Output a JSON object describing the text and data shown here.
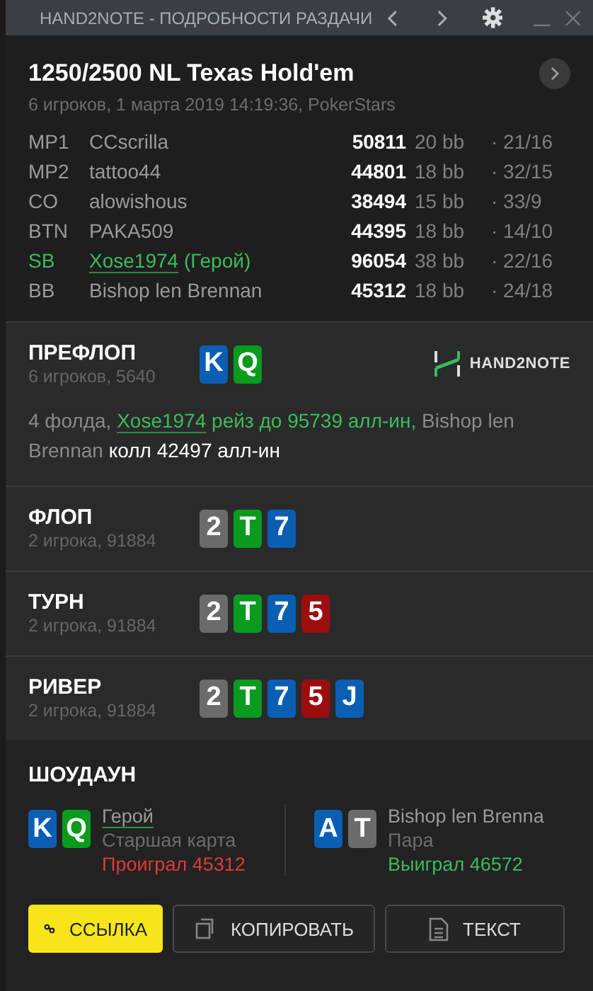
{
  "window": {
    "title": "HAND2NOTE - ПОДРОБНОСТИ РАЗДАЧИ"
  },
  "hand": {
    "title": "1250/2500 NL Texas Hold'em",
    "subtitle": "6 игроков, 1 марта 2019 14:19:36, PokerStars"
  },
  "seats": [
    {
      "position": "MP1",
      "name": "CCscrilla",
      "hero": false,
      "stack": "50811",
      "bb": "20 bb",
      "stats": "· 21/16"
    },
    {
      "position": "MP2",
      "name": "tattoo44",
      "hero": false,
      "stack": "44801",
      "bb": "18 bb",
      "stats": "· 32/15"
    },
    {
      "position": "CO",
      "name": "alowishous",
      "hero": false,
      "stack": "38494",
      "bb": "15 bb",
      "stats": "· 33/9"
    },
    {
      "position": "BTN",
      "name": "PAKA509",
      "hero": false,
      "stack": "44395",
      "bb": "18 bb",
      "stats": "· 14/10"
    },
    {
      "position": "SB",
      "name": "Xose1974",
      "hero_tag": "(Герой)",
      "hero": true,
      "stack": "96054",
      "bb": "38 bb",
      "stats": "· 22/16"
    },
    {
      "position": "BB",
      "name": "Bishop len Brennan",
      "hero": false,
      "stack": "45312",
      "bb": "18 bb",
      "stats": "· 24/18"
    }
  ],
  "streets": [
    {
      "name": "ПРЕФЛОП",
      "info": "6 игроков, 5640",
      "cards": [
        {
          "rank": "K",
          "color": "#0a5fb4"
        },
        {
          "rank": "Q",
          "color": "#0a9a1e"
        }
      ],
      "logo": "HAND2NOTE",
      "actions": [
        {
          "kind": "plain",
          "text": "4 фолда, "
        },
        {
          "kind": "hero_link",
          "text": "Xose1974"
        },
        {
          "kind": "hero",
          "text": " рейз до 95739 алл-ин,"
        },
        {
          "kind": "plain",
          "text": " Bishop len Brennan "
        },
        {
          "kind": "bold",
          "text": "колл 42497 алл-ин"
        }
      ]
    },
    {
      "name": "ФЛОП",
      "info": "2 игрока, 91884",
      "cards": [
        {
          "rank": "2",
          "color": "#6b6b6b"
        },
        {
          "rank": "T",
          "color": "#0a9a1e"
        },
        {
          "rank": "7",
          "color": "#0a5fb4"
        }
      ]
    },
    {
      "name": "ТУРН",
      "info": "2 игрока, 91884",
      "cards": [
        {
          "rank": "2",
          "color": "#6b6b6b"
        },
        {
          "rank": "T",
          "color": "#0a9a1e"
        },
        {
          "rank": "7",
          "color": "#0a5fb4"
        },
        {
          "rank": "5",
          "color": "#9c0d0d"
        }
      ]
    },
    {
      "name": "РИВЕР",
      "info": "2 игрока, 91884",
      "cards": [
        {
          "rank": "2",
          "color": "#6b6b6b"
        },
        {
          "rank": "T",
          "color": "#0a9a1e"
        },
        {
          "rank": "7",
          "color": "#0a5fb4"
        },
        {
          "rank": "5",
          "color": "#9c0d0d"
        },
        {
          "rank": "J",
          "color": "#0a5fb4"
        }
      ]
    }
  ],
  "showdown": {
    "title": "ШОУДАУН",
    "players": [
      {
        "name": "Герой",
        "hero": true,
        "cards": [
          {
            "rank": "K",
            "color": "#0a5fb4"
          },
          {
            "rank": "Q",
            "color": "#0a9a1e"
          }
        ],
        "hand": "Старшая карта",
        "result": "Проиграл 45312",
        "kind": "lose"
      },
      {
        "name": "Bishop len Brenna",
        "hero": false,
        "cards": [
          {
            "rank": "A",
            "color": "#0a5fb4"
          },
          {
            "rank": "T",
            "color": "#6b6b6b"
          }
        ],
        "hand": "Пара",
        "result": "Выиграл 46572",
        "kind": "win"
      }
    ]
  },
  "buttons": [
    {
      "label": "ССЫЛКА",
      "kind": "link",
      "primary": true
    },
    {
      "label": "КОПИРОВАТЬ",
      "kind": "copy",
      "primary": false
    },
    {
      "label": "ТЕКСТ",
      "kind": "text",
      "primary": false
    }
  ]
}
